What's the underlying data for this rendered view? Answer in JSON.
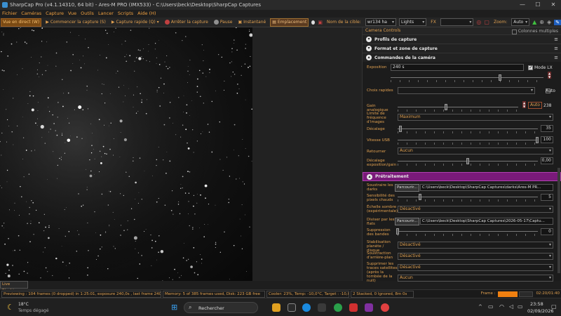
{
  "window": {
    "title": "SharpCap Pro (v4.1.14310, 64 bit) - Ares-M PRO (IMX533) - C:\\Users\\beck\\Desktop\\SharpCap Captures"
  },
  "menu": [
    "Fichier",
    "Caméras",
    "Capture",
    "Vue",
    "Outils",
    "Lancer",
    "Scripts",
    "Aide (H)"
  ],
  "toolbar": {
    "live_label": "Vue en direct (W)",
    "start_capture": "Commencer la capture (S)",
    "quick_capture": "Capture rapide (Q)",
    "stop_capture": "Arrêter la capture",
    "pause": "Pause",
    "snapshot": "Instantané",
    "location": "Emplacement",
    "target_label": "Nom de la cible:",
    "target_value": "wr134 ha",
    "preset_value": "Lights",
    "fx_label": "FX",
    "zoom_label": "Zoom:",
    "zoom_value": "Auto"
  },
  "panel": {
    "title": "Camera Controls",
    "multicol_label": "Colonnes multiples",
    "sections": {
      "profiles": "Profils de capture",
      "format": "Format et zone de capture",
      "camera": "Commandes de la caméra",
      "preprocessing": "Prétraitement"
    },
    "camera": {
      "exposure_label": "Exposition",
      "exposure_value": "240 s",
      "lx_label": "Mode LX",
      "quick_choices_label": "Choix rapides",
      "auto_label": "Auto",
      "gain_label": "Gain analogique",
      "gain_auto": "Auto",
      "gain_value": "238",
      "freq_label": "Limite de fréquence d'images",
      "freq_value": "Maximum",
      "offset_label": "Décalage",
      "offset_value": "35",
      "usb_label": "Vitesse USB",
      "usb_value": "100",
      "flip_label": "Retourner",
      "flip_value": "Aucun",
      "expo_offset_label": "Décalage exposition/gain",
      "expo_offset_value": "0,00"
    },
    "pre": {
      "darks_label": "Soustraire les darks",
      "darks_browse": "Parcourir...",
      "darks_path": "C:\\Users\\beck\\Desktop\\SharpCap Captures\\darks\\Ares-M PR...",
      "hotpix_label": "Sensibilité des pixels chauds",
      "hotpix_value": "5",
      "dark_scale_label": "Échelle sombre (expérimentale)",
      "dark_scale_value": "Désactivé",
      "flats_label": "Diviser par les flats",
      "flats_browse": "Parcourir...",
      "flats_path": "C:\\Users\\beck\\Desktop\\SharpCap Captures\\2026-05-17\\Captu...",
      "bands_label": "Suppression des bandes",
      "bands_value": "0",
      "stab_label": "Stabilisation planète / disque",
      "stab_value": "Désactivé",
      "bg_label": "Soustraction d'arrière-plan",
      "bg_value": "Désactivé",
      "sat_label": "Supprimer les traces satellites (après la tombée de la nuit)",
      "sat_value": "Désactivé",
      "last_value": "Aucun"
    }
  },
  "live_stacking": "Live Stacking",
  "status": {
    "preview": "Previewing : 104 frames (0 dropped) in 1:25:01, exposure 240,0s , last frame 240,0s",
    "memory": "Memory: 5 of 385 frames used, Disk: 223 GB free",
    "cooler": "Cooler: 23%, Temp: -10,0°C, Target : -10,0°",
    "stacked": "2 Stacked, 0 Ignored, 8m 0s",
    "frame_label": "Frame :",
    "elapsed": "02:20/01:40"
  },
  "taskbar": {
    "temp": "18°C",
    "weather": "Temps dégagé",
    "search": "Rechercher",
    "time": "23:58",
    "date": "02/09/2026"
  },
  "colors": {
    "accent": "#e0a050",
    "purple": "#7a1a7a",
    "live": "#7a4a14"
  }
}
